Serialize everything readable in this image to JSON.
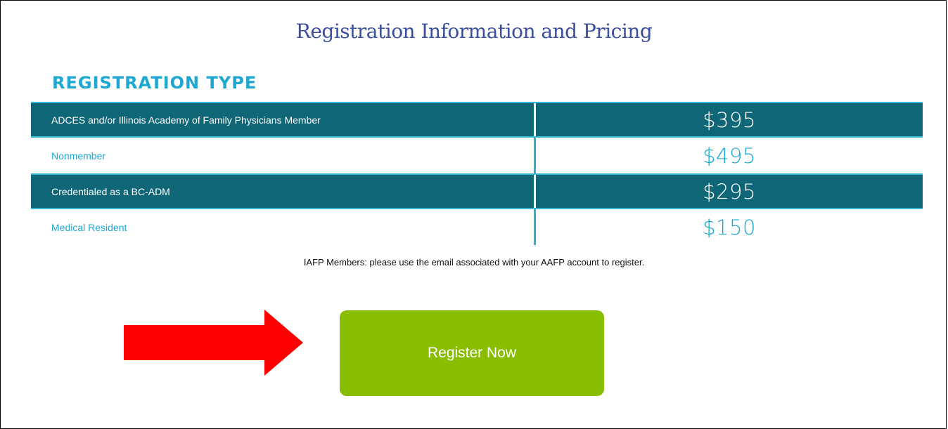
{
  "title": "Registration Information and Pricing",
  "section_heading": "REGISTRATION TYPE",
  "pricing_rows": [
    {
      "label": "ADCES and/or Illinois Academy of Family Physicians Member",
      "price": "$395"
    },
    {
      "label": "Nonmember",
      "price": "$495"
    },
    {
      "label": "Credentialed as a BC-ADM",
      "price": "$295"
    },
    {
      "label": "Medical Resident",
      "price": "$150"
    }
  ],
  "note": "IAFP Members: please use the email associated with your AAFP account to register.",
  "register_button_label": "Register Now",
  "colors": {
    "title": "#3a4f9e",
    "accent": "#1ea7cf",
    "dark_row": "#0e6676",
    "button": "#89bd00",
    "arrow": "#ff0000"
  },
  "icons": {
    "annotation_arrow": "red-arrow-right-icon"
  }
}
